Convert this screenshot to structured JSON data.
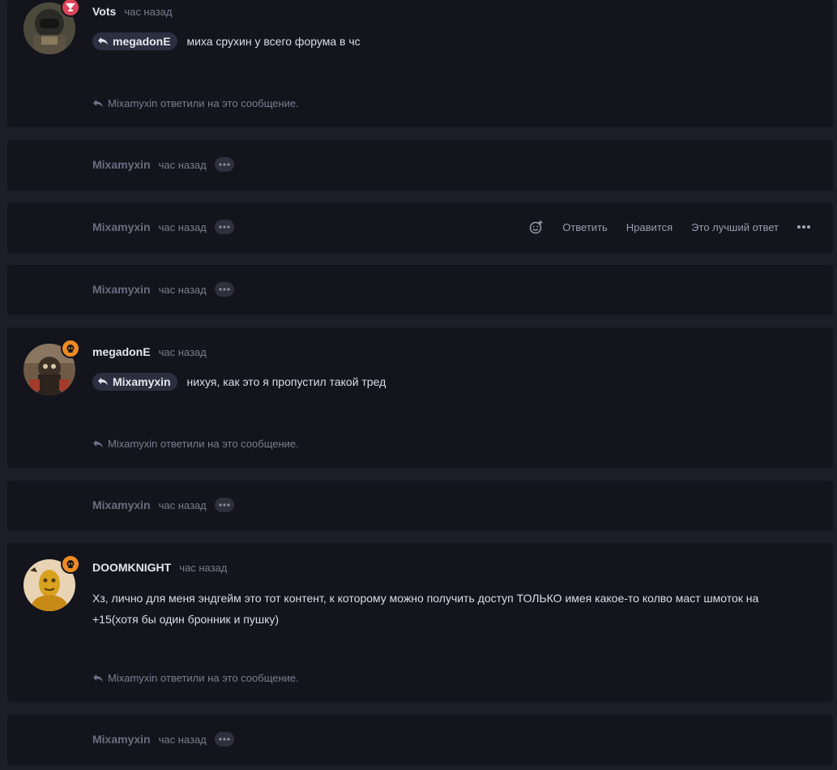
{
  "posts": [
    {
      "author": "Vots",
      "time": "час назад",
      "quote_user": "megadonE",
      "text": "миха срухин у всего форума в чс",
      "replied_note": "Mixamyxin ответили на это сообщение."
    },
    {
      "author": "Mixamyxin",
      "time": "час назад"
    },
    {
      "author": "Mixamyxin",
      "time": "час назад",
      "actions": {
        "reply": "Ответить",
        "like": "Нравится",
        "best": "Это лучший ответ"
      }
    },
    {
      "author": "Mixamyxin",
      "time": "час назад"
    },
    {
      "author": "megadonE",
      "time": "час назад",
      "quote_user": "Mixamyxin",
      "text": "нихуя, как это я пропустил такой тред",
      "replied_note": "Mixamyxin ответили на это сообщение."
    },
    {
      "author": "Mixamyxin",
      "time": "час назад"
    },
    {
      "author": "DOOMKNIGHT",
      "time": "час назад",
      "text": "Хз, лично для меня эндгейм это тот контент, к которому можно получить доступ ТОЛЬКО имея какое-то колво маст шмоток на +15(хотя бы один бронник и пушку)",
      "replied_note": "Mixamyxin ответили на это сообщение."
    },
    {
      "author": "Mixamyxin",
      "time": "час назад"
    }
  ],
  "colors": {
    "background": "#1c1d27",
    "card": "#13141c",
    "badge_red": "#e0435a",
    "badge_orange": "#f08a24"
  },
  "icons": {
    "reply": "reply-arrow-icon",
    "more": "ellipsis-icon",
    "react": "add-reaction-icon",
    "badge_trophy": "trophy-icon",
    "badge_skull": "skull-icon"
  }
}
